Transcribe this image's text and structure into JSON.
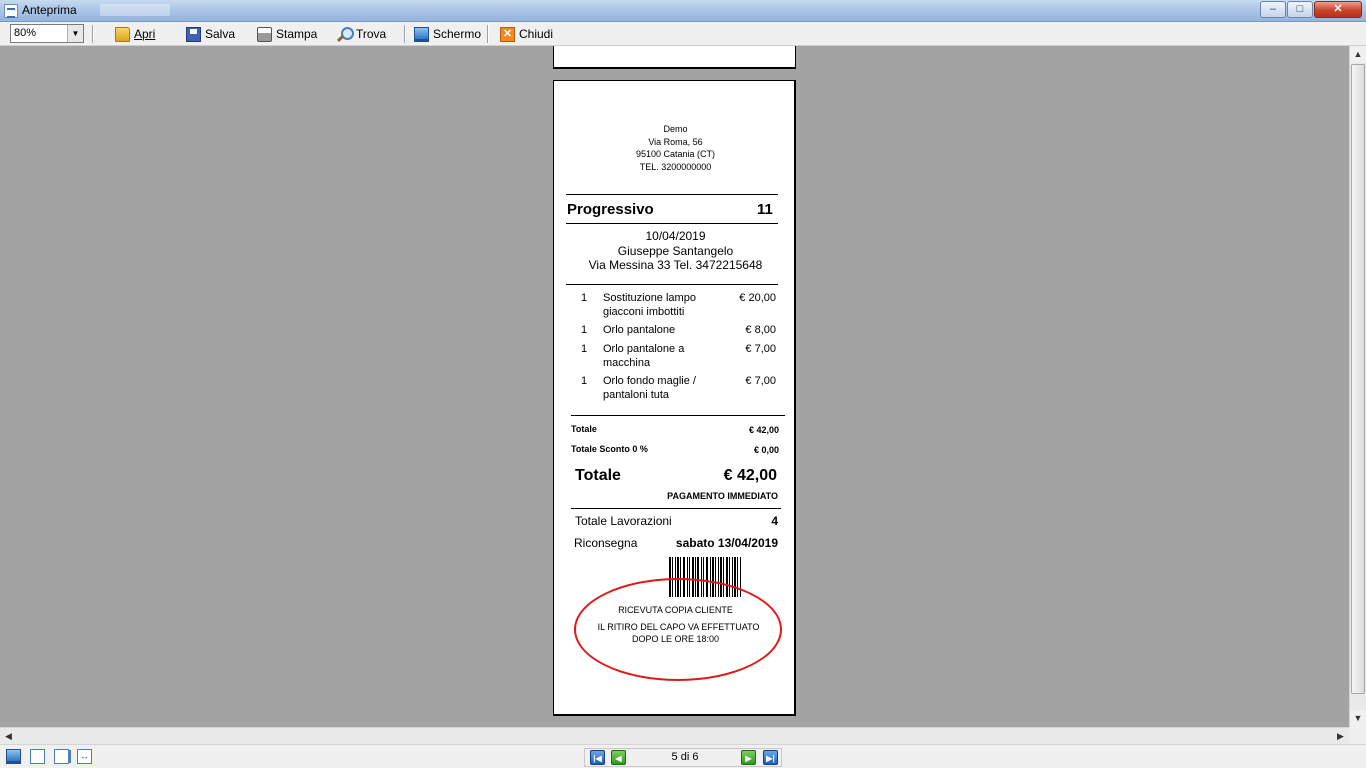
{
  "window": {
    "title": "Anteprima",
    "minimize": "–",
    "maximize": "□",
    "close": "✕"
  },
  "toolbar": {
    "zoom_value": "80%",
    "buttons": [
      {
        "label": "Apri",
        "icon": "folder-open-icon"
      },
      {
        "label": "Salva",
        "icon": "floppy-disk-icon"
      },
      {
        "label": "Stampa",
        "icon": "printer-icon"
      },
      {
        "label": "Trova",
        "icon": "magnifier-icon"
      },
      {
        "label": "Schermo",
        "icon": "monitor-icon"
      },
      {
        "label": "Chiudi",
        "icon": "close-box-icon"
      }
    ]
  },
  "receipt": {
    "header": [
      "Demo",
      "Via Roma, 56",
      "95100 Catania (CT)",
      "TEL. 3200000000"
    ],
    "progressive_label": "Progressivo",
    "progressive_number": "11",
    "date": "10/04/2019",
    "customer_name": "Giuseppe Santangelo",
    "customer_address": "Via Messina 33 Tel. 3472215648",
    "items": [
      {
        "qty": "1",
        "desc_line1": "Sostituzione lampo",
        "desc_line2": "giacconi imbottiti",
        "price": "€ 20,00"
      },
      {
        "qty": "1",
        "desc_line1": "Orlo pantalone",
        "desc_line2": "",
        "price": "€ 8,00"
      },
      {
        "qty": "1",
        "desc_line1": "Orlo pantalone a",
        "desc_line2": "macchina",
        "price": "€ 7,00"
      },
      {
        "qty": "1",
        "desc_line1": "Orlo fondo maglie /",
        "desc_line2": "pantaloni tuta",
        "price": "€ 7,00"
      }
    ],
    "subtotal_label": "Totale",
    "subtotal_value": "€ 42,00",
    "discount_label": "Totale  Sconto 0 %",
    "discount_value": "€ 0,00",
    "total_label": "Totale",
    "total_value": "€ 42,00",
    "payment": "PAGAMENTO IMMEDIATO",
    "works_label": "Totale Lavorazioni",
    "works_value": "4",
    "return_label": "Riconsegna",
    "return_value": "sabato 13/04/2019",
    "stamp_line1": "RICEVUTA COPIA CLIENTE",
    "stamp_line2": "IL RITIRO DEL CAPO VA EFFETTUATO",
    "stamp_line3": "DOPO LE ORE  18:00",
    "stamp_color": "#e01818"
  },
  "statusbar": {
    "page_indicator": "5 di 6",
    "icons": [
      "monitor-icon",
      "single-page-icon",
      "two-pages-icon",
      "fit-width-icon"
    ]
  }
}
